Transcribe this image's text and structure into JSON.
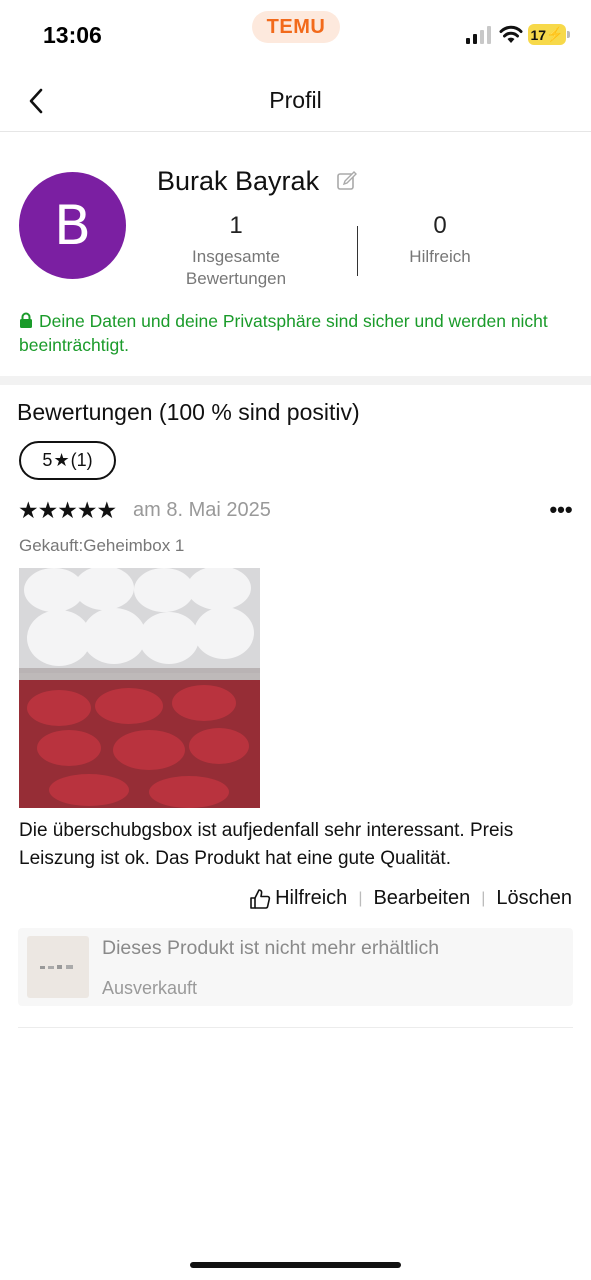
{
  "status_bar": {
    "time": "13:06",
    "app_badge": "TEMU",
    "battery": "17",
    "icons": [
      "signal-icon",
      "wifi-icon",
      "battery-icon"
    ]
  },
  "nav": {
    "title": "Profil",
    "back_icon": "chevron-left-icon"
  },
  "profile": {
    "avatar_letter": "B",
    "avatar_color": "#7b1fa2",
    "name": "Burak Bayrak",
    "reviews_count": "1",
    "reviews_label_line1": "Insgesamte",
    "reviews_label_line2": "Bewertungen",
    "helpful_count": "0",
    "helpful_label": "Hilfreich",
    "privacy_text": "Deine Daten und deine Privatsphäre sind sicher und werden nicht beeinträchtigt.",
    "privacy_color": "#1a9b2a"
  },
  "reviews": {
    "heading": "Bewertungen (100 % sind positiv)",
    "filter_chip": {
      "rating": "5",
      "count": "(1)"
    },
    "items": [
      {
        "rating": 5,
        "stars": "★★★★★",
        "date": "am 8. Mai 2025",
        "purchased": "Gekauft:Geheimbox 1",
        "text": "Die überschubgsbox ist aufjedenfall sehr interessant. Preis Leiszung ist ok. Das Produkt hat eine gute Qualität.",
        "actions": {
          "helpful": "Hilfreich",
          "edit": "Bearbeiten",
          "delete": "Löschen"
        },
        "product": {
          "title": "Dieses Produkt ist nicht mehr erhältlich",
          "status": "Ausverkauft"
        }
      }
    ]
  }
}
